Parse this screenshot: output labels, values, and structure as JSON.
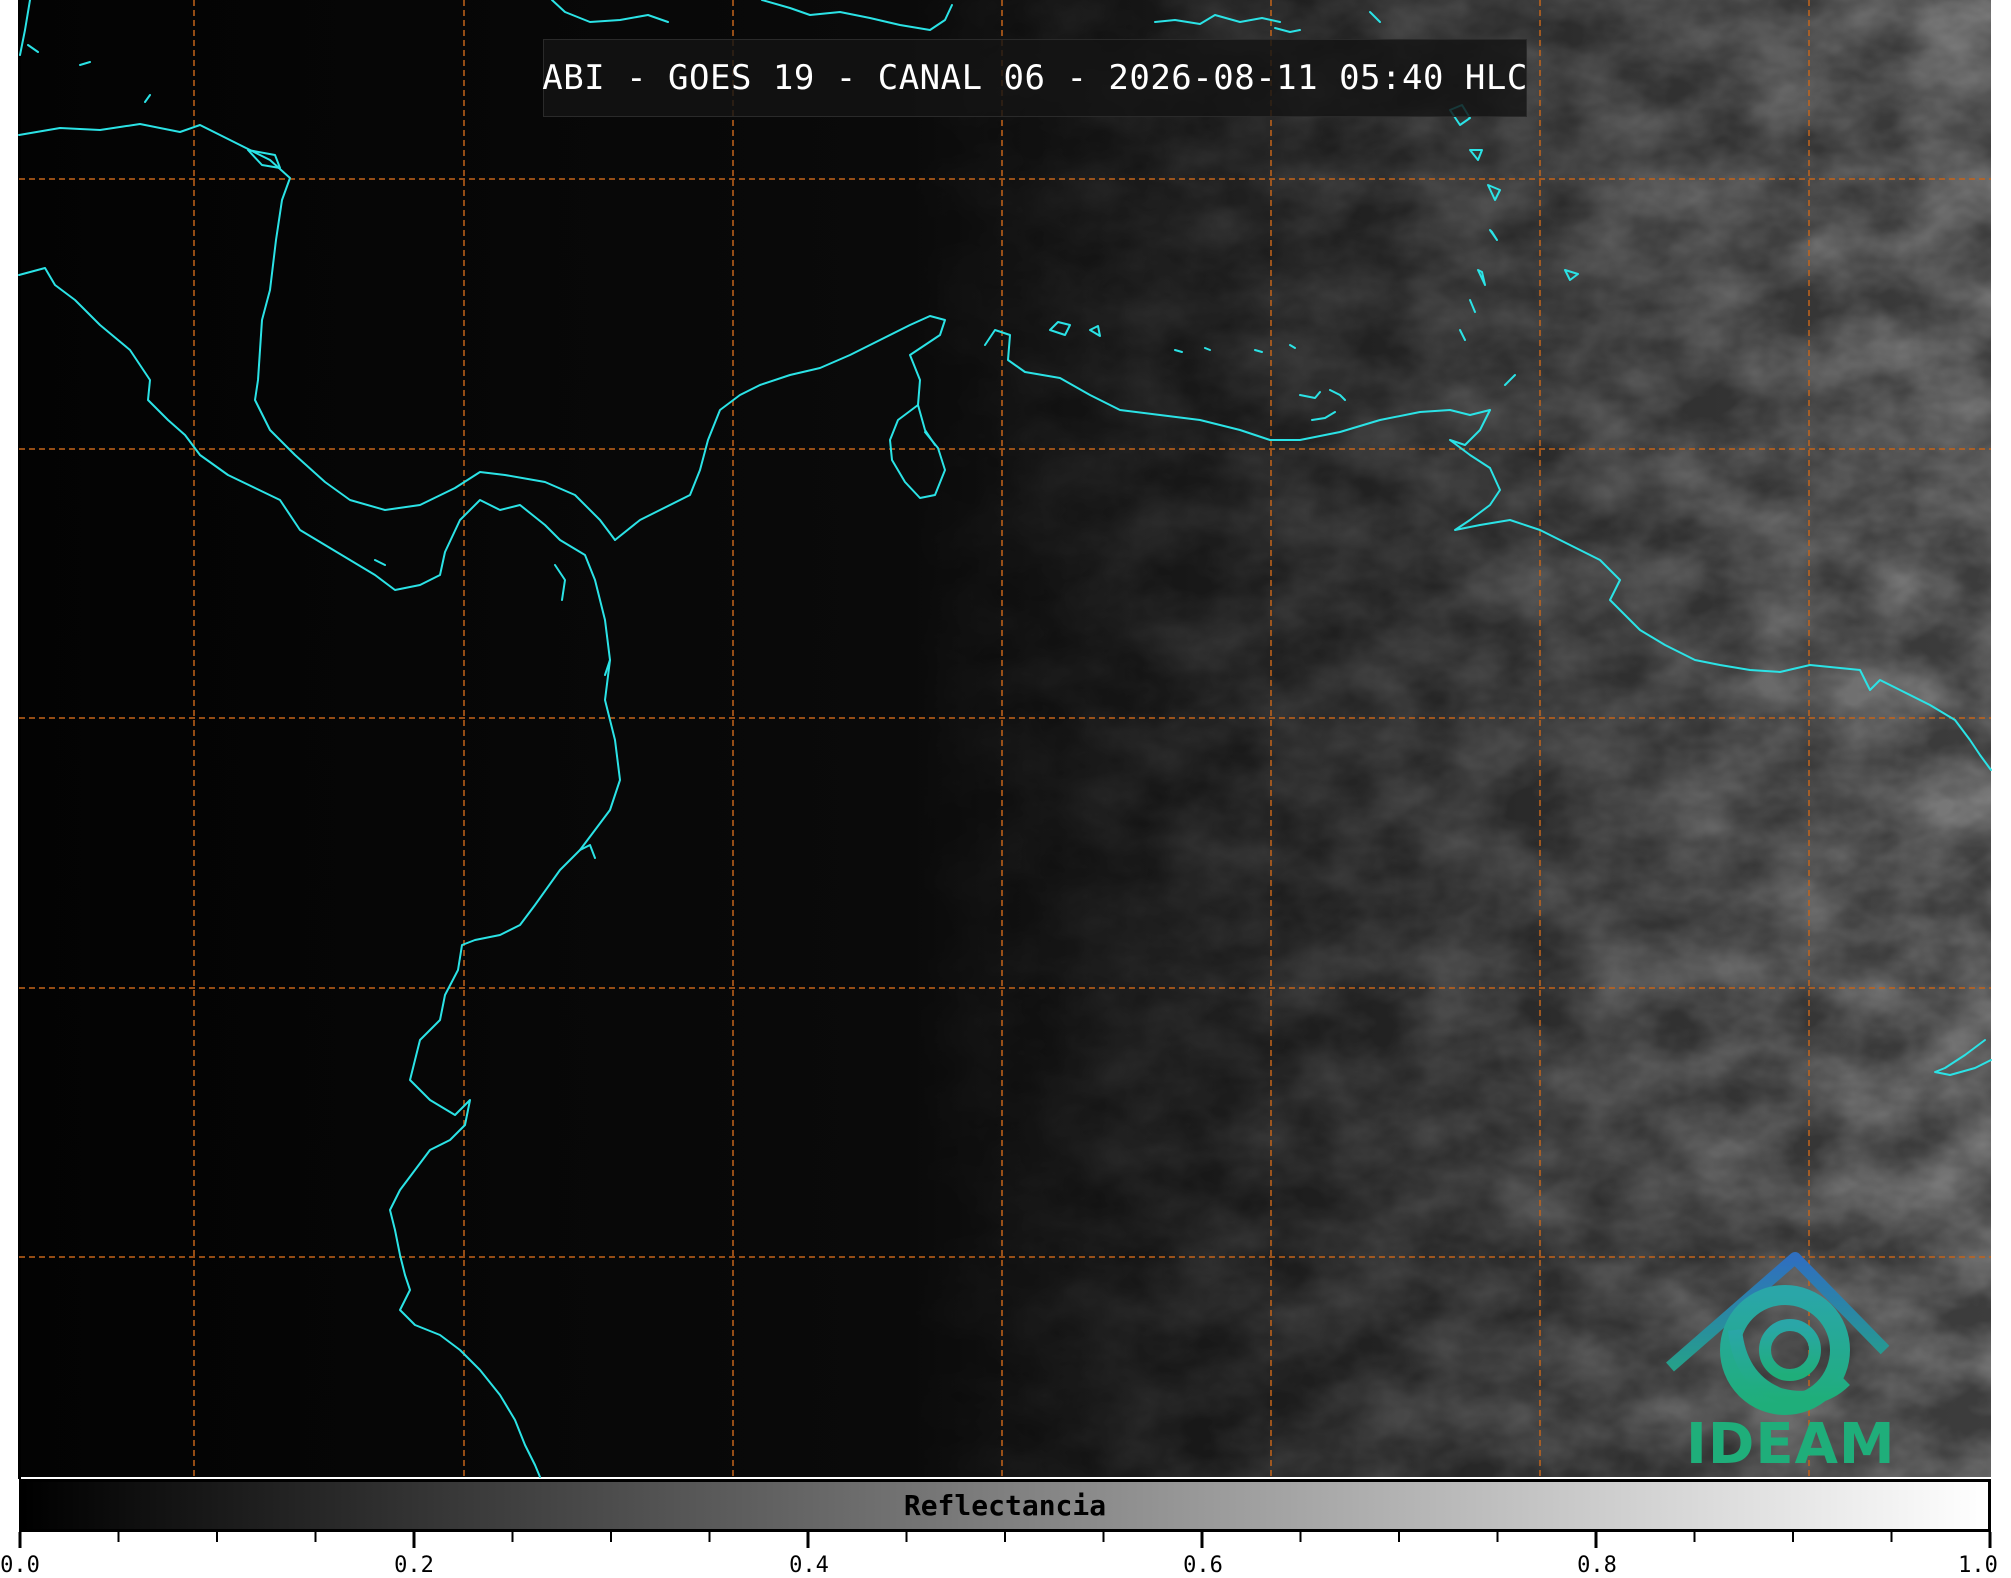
{
  "title": "ABI - GOES 19 - CANAL 06 - 2026-08-11 05:40 HLC",
  "logo": {
    "text": "IDEAM",
    "colors": {
      "roof": "#2f78c0",
      "swirl": "#22a884",
      "text": "#1fae7a"
    }
  },
  "colorbar": {
    "label": "Reflectancia",
    "ticks": [
      "0.0",
      "0.2",
      "0.4",
      "0.6",
      "0.8",
      "1.0"
    ],
    "minor_tick_count": 20,
    "colors": {
      "low": "#000000",
      "high": "#ffffff"
    }
  },
  "map": {
    "colors": {
      "coastline": "#2be3e6",
      "grid": "#c4641a",
      "background": "#030303"
    }
  }
}
